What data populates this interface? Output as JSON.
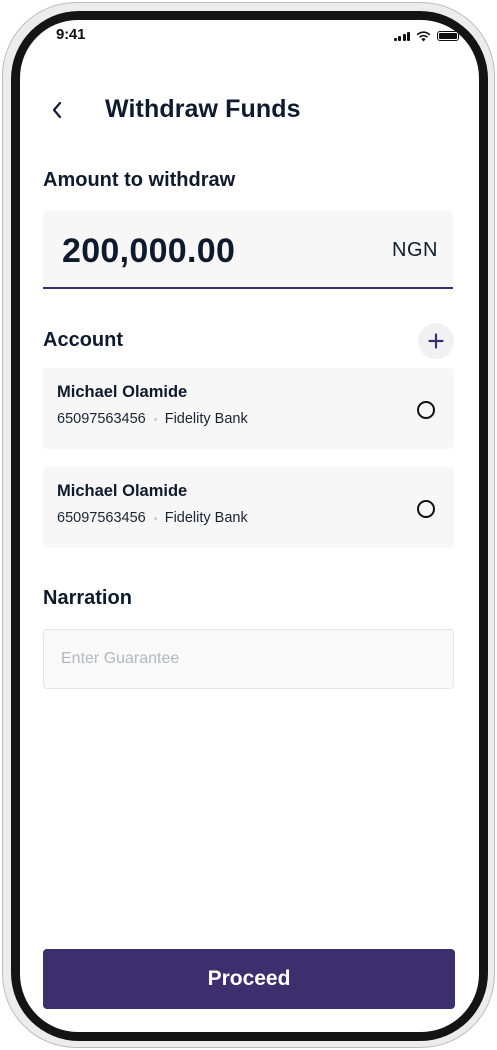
{
  "status_bar": {
    "time": "9:41"
  },
  "header": {
    "title": "Withdraw Funds"
  },
  "amount": {
    "label": "Amount to withdraw",
    "value": "200,000.00",
    "currency": "NGN"
  },
  "accounts": {
    "label": "Account",
    "items": [
      {
        "name": "Michael Olamide",
        "number": "65097563456",
        "bank": "Fidelity Bank",
        "selected": false
      },
      {
        "name": "Michael Olamide",
        "number": "65097563456",
        "bank": "Fidelity Bank",
        "selected": false
      }
    ]
  },
  "narration": {
    "label": "Narration",
    "placeholder": "Enter Guarantee",
    "value": ""
  },
  "proceed_label": "Proceed",
  "colors": {
    "primary": "#3d2f6e",
    "text_dark": "#0f1b2d",
    "card_bg": "#f7f7f7"
  },
  "icons": {
    "back": "chevron-left-icon",
    "add": "plus-icon",
    "signal": "signal-icon",
    "wifi": "wifi-icon",
    "battery": "battery-icon"
  }
}
